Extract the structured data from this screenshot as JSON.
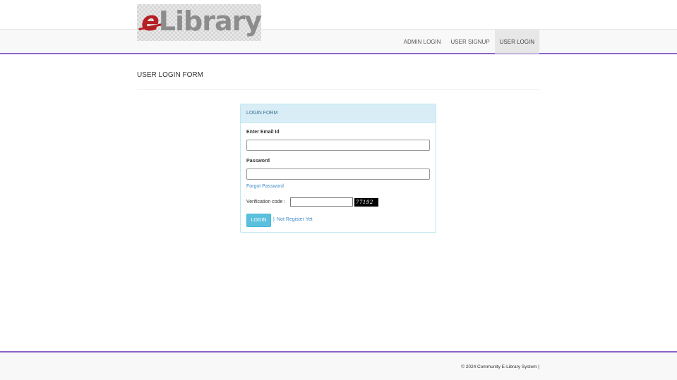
{
  "brand": {
    "logo_e": "e",
    "logo_rest": "Library"
  },
  "nav": {
    "items": [
      "ADMIN LOGIN",
      "USER SIGNUP",
      "USER LOGIN"
    ]
  },
  "page": {
    "title": "USER LOGIN FORM"
  },
  "login_form": {
    "heading": "LOGIN FORM",
    "email_label": "Enter Email Id",
    "email_value": "",
    "password_label": "Password",
    "password_value": "",
    "forgot_link": "Forgot Password",
    "verification_label": "Verification code :",
    "verification_value": "",
    "captcha_code": "77192",
    "login_button": "LOGIN",
    "separator": "|",
    "register_link": "Not Register Yet"
  },
  "footer": {
    "text": "© 2024 Community E-Library System |"
  },
  "colors": {
    "accent": "#8a63c7",
    "panel_heading_bg": "#d9edf7",
    "button": "#5bc0de",
    "link": "#428bca",
    "logo_red": "#b52025"
  }
}
